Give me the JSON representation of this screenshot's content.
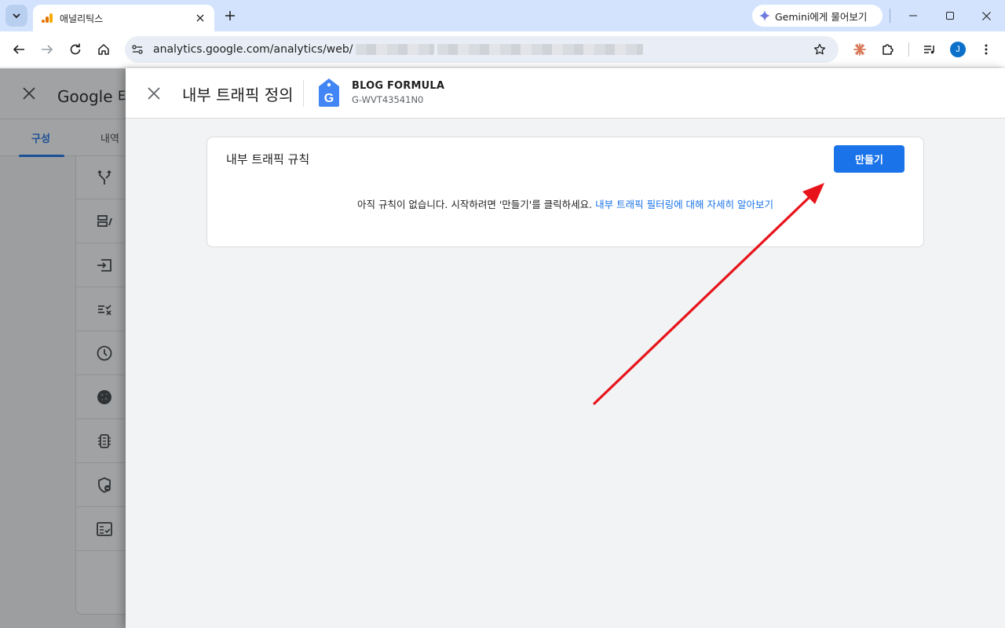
{
  "browser": {
    "tab_title": "애널리틱스",
    "url": "analytics.google.com/analytics/web/",
    "gemini_label": "Gemini에게 물어보기",
    "avatar_initial": "J"
  },
  "background_page": {
    "title": "Google 태",
    "tabs": [
      {
        "label": "구성",
        "active": true
      },
      {
        "label": "내역",
        "active": false
      }
    ],
    "list_icons": [
      "merge-icon",
      "table-edit-icon",
      "input-icon",
      "checklist-icon",
      "clock-icon",
      "cookie-icon",
      "chip-icon",
      "shield-icon",
      "fact-check-icon"
    ]
  },
  "drawer": {
    "title": "내부 트래픽 정의",
    "stream_name": "BLOG FORMULA",
    "stream_id": "G-WVT43541N0",
    "card": {
      "title": "내부 트래픽 규칙",
      "create_label": "만들기",
      "empty_message": "아직 규칙이 없습니다. 시작하려면 '만들기'를 클릭하세요.",
      "learn_more": "내부 트래픽 필터링에 대해 자세히 알아보기"
    }
  },
  "colors": {
    "accent": "#1a73e8",
    "annotation_arrow": "#e8141b",
    "tabstrip": "#d3e3fd"
  }
}
